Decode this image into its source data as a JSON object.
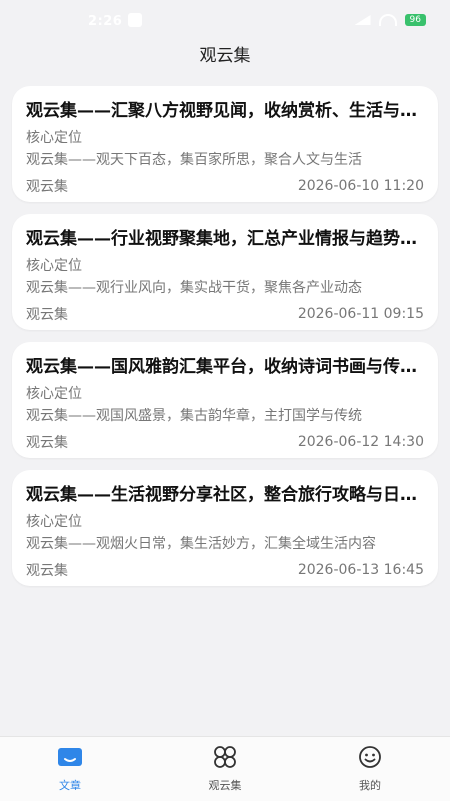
{
  "status": {
    "time": "2:26",
    "battery": "96"
  },
  "header": {
    "title": "观云集"
  },
  "articles": [
    {
      "title": "观云集——汇聚八方视野见闻，收纳赏析、生活与文化百态",
      "subtitle": "核心定位",
      "desc": "观云集——观天下百态，集百家所思，聚合人文与生活",
      "source": "观云集",
      "date": "2026-06-10 11:20"
    },
    {
      "title": "观云集——行业视野聚集地，汇总产业情报与趋势分析",
      "subtitle": "核心定位",
      "desc": "观云集——观行业风向，集实战干货，聚焦各产业动态",
      "source": "观云集",
      "date": "2026-06-11 09:15"
    },
    {
      "title": "观云集——国风雅韵汇集平台，收纳诗词书画与传统文化",
      "subtitle": "核心定位",
      "desc": "观云集——观国风盛景，集古韵华章，主打国学与传统",
      "source": "观云集",
      "date": "2026-06-12 14:30"
    },
    {
      "title": "观云集——生活视野分享社区，整合旅行攻略与日常分享",
      "subtitle": "核心定位",
      "desc": "观云集——观烟火日常，集生活妙方，汇集全域生活内容",
      "source": "观云集",
      "date": "2026-06-13 16:45"
    }
  ],
  "tabs": [
    {
      "label": "文章",
      "icon": "article-icon",
      "active": true
    },
    {
      "label": "观云集",
      "icon": "grid-icon",
      "active": false
    },
    {
      "label": "我的",
      "icon": "smiley-icon",
      "active": false
    }
  ],
  "colors": {
    "accent": "#2f86e8",
    "background": "#f2f2f4",
    "card": "#ffffff"
  }
}
